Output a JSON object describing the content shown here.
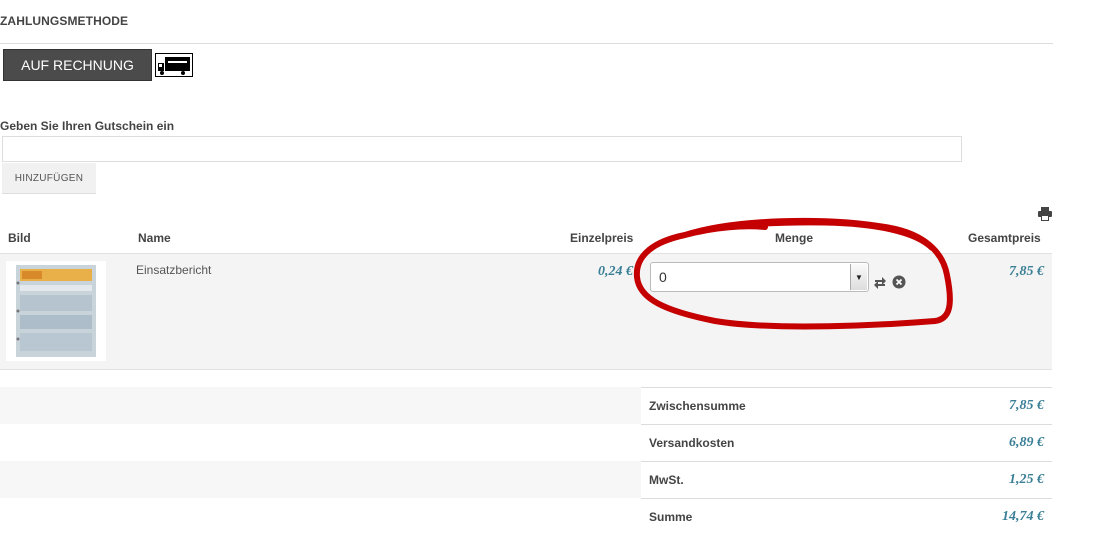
{
  "payment": {
    "title": "ZAHLUNGSMETHODE",
    "method_label": "AUF RECHNUNG",
    "method_icon": "truck-icon"
  },
  "coupon": {
    "label": "Geben Sie Ihren Gutschein ein",
    "value": "",
    "placeholder": "",
    "add_label": "HINZUFÜGEN"
  },
  "cart": {
    "headers": {
      "image": "Bild",
      "name": "Name",
      "unit_price": "Einzelpreis",
      "quantity": "Menge",
      "total": "Gesamtpreis"
    },
    "items": [
      {
        "name": "Einsatzbericht",
        "unit_price": "0,24 €",
        "quantity": "0",
        "total": "7,85 €"
      }
    ]
  },
  "summary": {
    "subtotal_label": "Zwischensumme",
    "subtotal_value": "7,85 €",
    "shipping_label": "Versandkosten",
    "shipping_value": "6,89 €",
    "tax_label": "MwSt.",
    "tax_value": "1,25 €",
    "total_label": "Summe",
    "total_value": "14,74 €"
  },
  "colors": {
    "accent_price": "#3a7f96",
    "button_dark": "#4b4b4b",
    "annotation": "#c40000"
  }
}
